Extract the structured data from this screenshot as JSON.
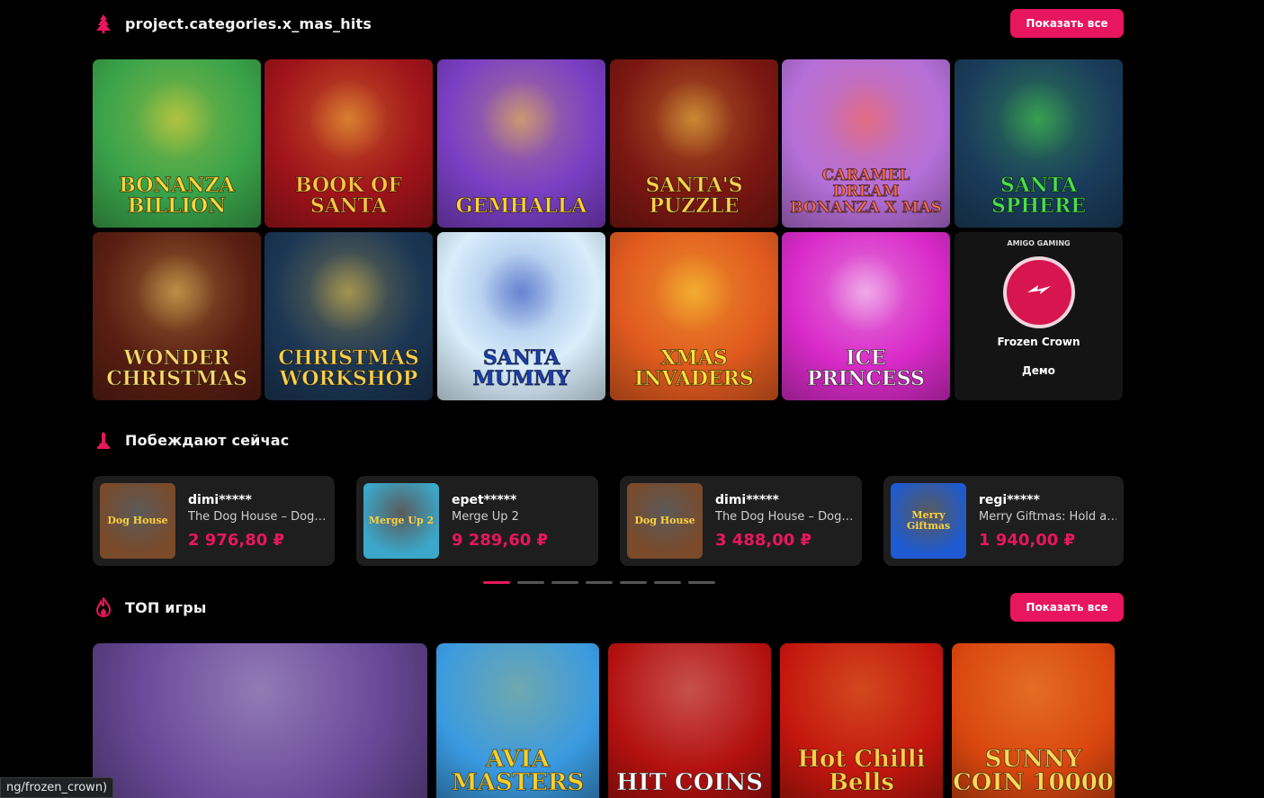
{
  "sections": {
    "xmas": {
      "title": "project.categories.x_mas_hits",
      "show_all": "Показать все"
    },
    "winners": {
      "title": "Побеждают сейчас"
    },
    "top": {
      "title": "ТОП игры",
      "show_all": "Показать все"
    }
  },
  "xmas_games": [
    {
      "name": "Bonanza Billion",
      "bg": "#3aa34a",
      "fg": "#ffd93a"
    },
    {
      "name": "Book of Santa",
      "bg": "#a1141a",
      "fg": "#ffc640"
    },
    {
      "name": "GEMhalla",
      "bg": "#7a3fc4",
      "fg": "#ffd23c"
    },
    {
      "name": "Santa's Puzzle",
      "bg": "#7d1712",
      "fg": "#ffd34a"
    },
    {
      "name": "Caramel Dream Bonanza X mas",
      "bg": "#b56fd8",
      "fg": "#ff6a4a"
    },
    {
      "name": "Santa Sphere",
      "bg": "#1a3d5c",
      "fg": "#4be04b"
    },
    {
      "name": "Wonder Christmas",
      "bg": "#5a1e12",
      "fg": "#ffd86a"
    },
    {
      "name": "Christmas Workshop",
      "bg": "#1b3654",
      "fg": "#ffd14d"
    },
    {
      "name": "Santa Mummy",
      "bg": "#d8eefb",
      "fg": "#1a3db5"
    },
    {
      "name": "Xmas Invaders",
      "bg": "#e05a1f",
      "fg": "#ffe43c"
    },
    {
      "name": "Ice Princess",
      "bg": "#d82ac8",
      "fg": "#ffffff"
    }
  ],
  "hover_game": {
    "provider": "AMIGO GAMING",
    "name": "Frozen Crown",
    "demo": "Демо"
  },
  "winners": [
    {
      "user": "dimi*****",
      "game": "The Dog House – Dog or Alive",
      "amount": "2 976,80 ₽",
      "thumb_text": "Dog House",
      "thumb_bg": "#7a4a2a"
    },
    {
      "user": "epet*****",
      "game": "Merge Up 2",
      "amount": "9 289,60 ₽",
      "thumb_text": "Merge Up 2",
      "thumb_bg": "#3ba7c9"
    },
    {
      "user": "dimi*****",
      "game": "The Dog House – Dog or Alive",
      "amount": "3 488,00 ₽",
      "thumb_text": "Dog House",
      "thumb_bg": "#7a4a2a"
    },
    {
      "user": "regi*****",
      "game": "Merry Giftmas: Hold and Win",
      "amount": "1 940,00 ₽",
      "thumb_text": "Merry Giftmas",
      "thumb_bg": "#1e5ad0"
    }
  ],
  "slider": {
    "count": 7,
    "active_index": 0
  },
  "top_games": [
    {
      "name": "",
      "bg": "#6a4a9a"
    },
    {
      "name": "AVIA MASTERS",
      "bg": "#3a9ae0",
      "fg": "#ffcf2a"
    },
    {
      "name": "HIT COINS",
      "bg": "#b3110f",
      "fg": "#ffffff"
    },
    {
      "name": "Hot Chilli Bells",
      "bg": "#c3160e",
      "fg": "#ffd04a"
    },
    {
      "name": "SUNNY COIN 10000",
      "bg": "#d9460f",
      "fg": "#ffd85a"
    }
  ],
  "status_url": "ng/frozen_crown)"
}
